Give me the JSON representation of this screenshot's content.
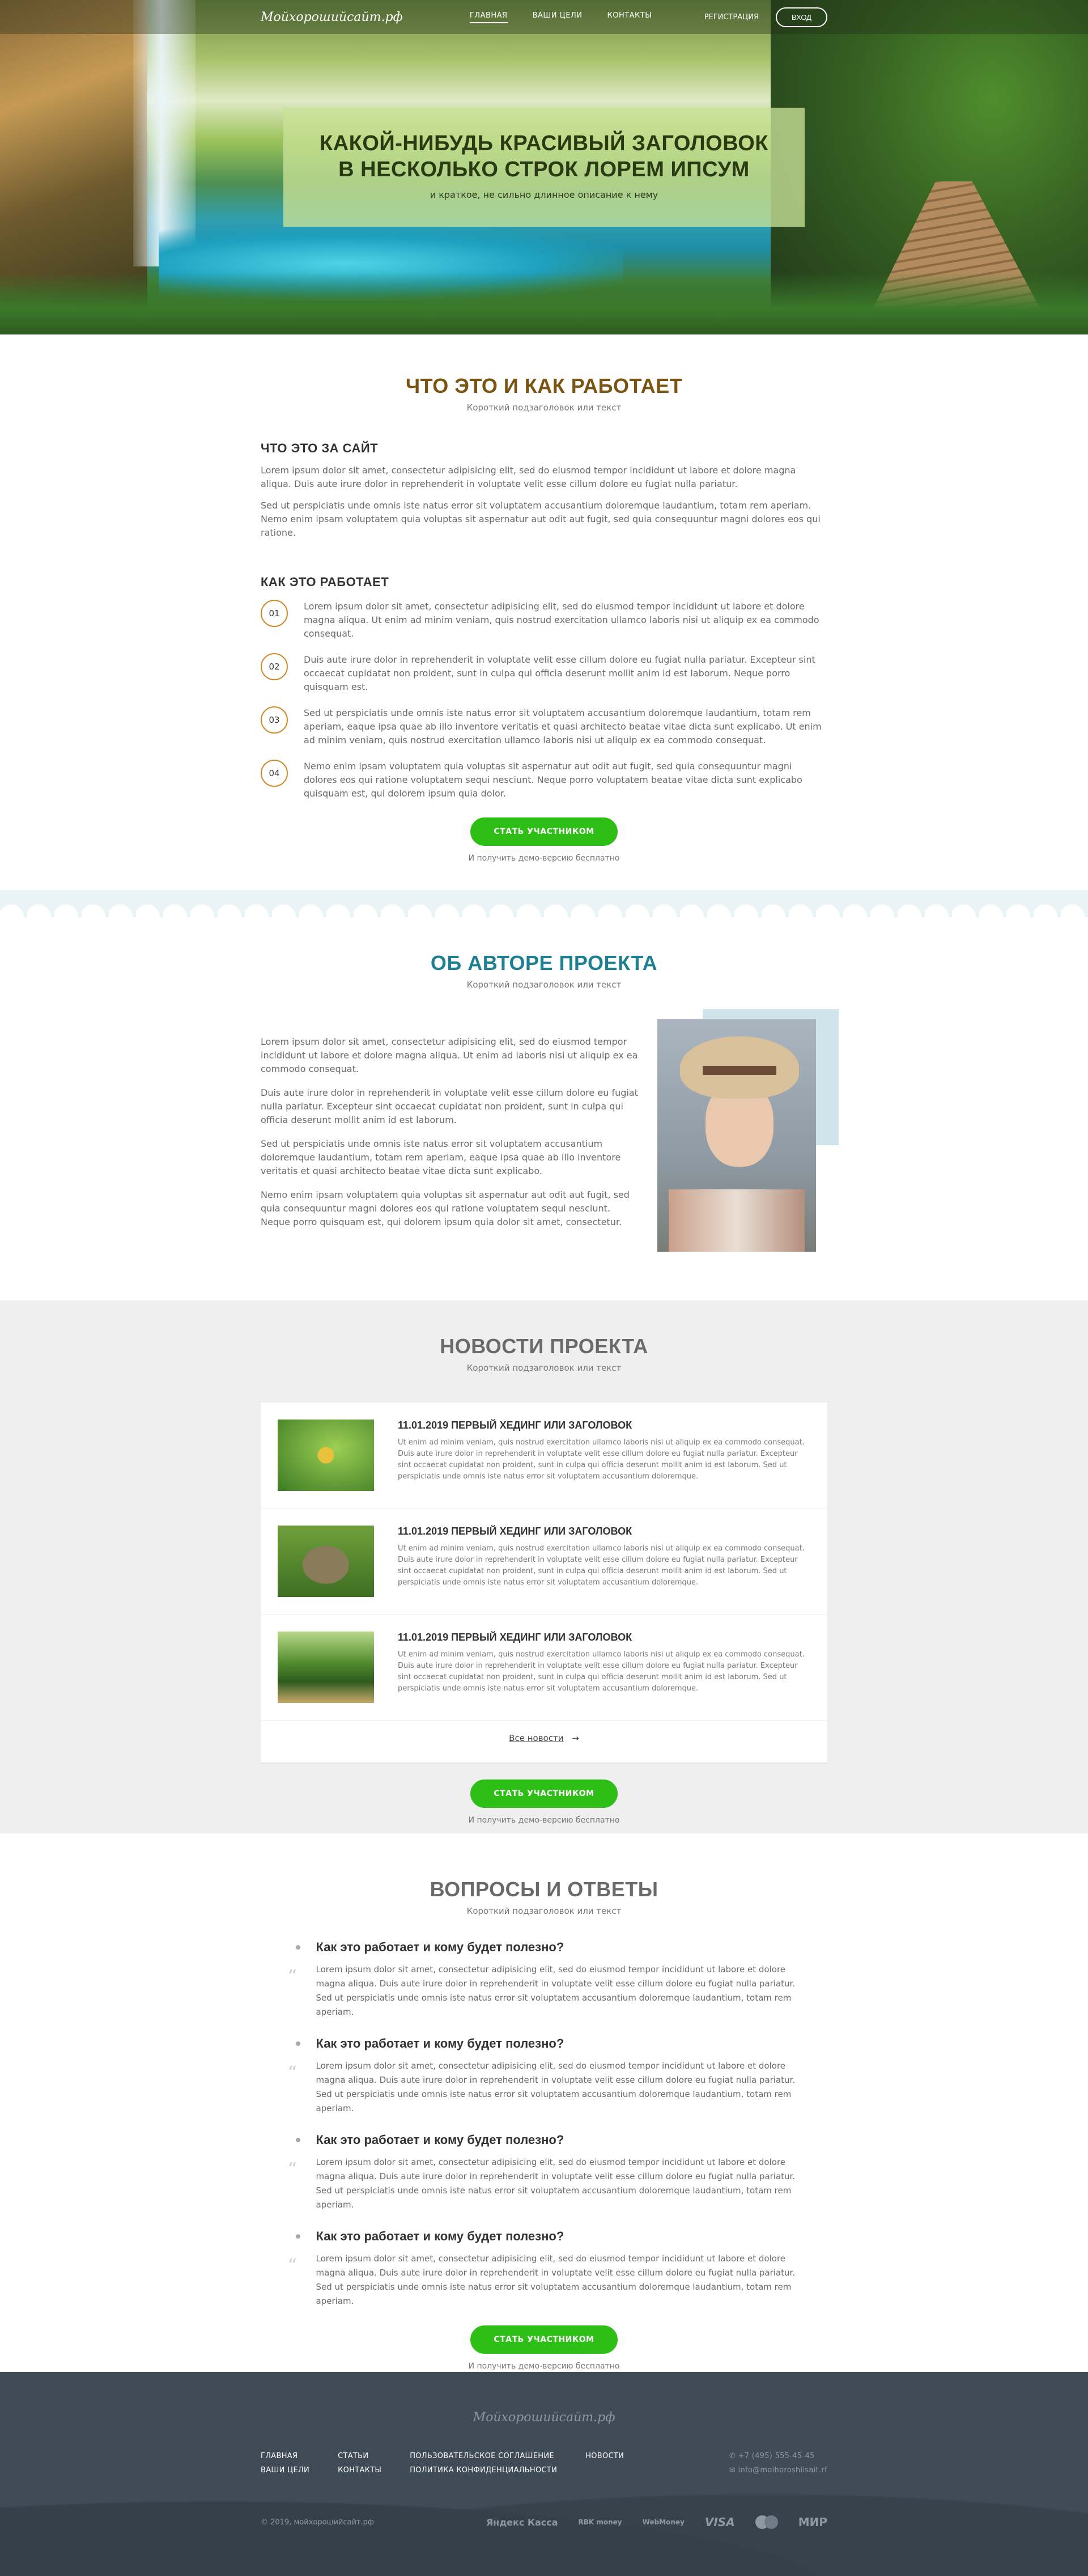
{
  "header": {
    "logo": "Мойхорошийсайт.рф",
    "nav": [
      "ГЛАВНАЯ",
      "ВАШИ ЦЕЛИ",
      "КОНТАКТЫ"
    ],
    "register": "РЕГИСТРАЦИЯ",
    "login": "ВХОД"
  },
  "hero": {
    "title_line1": "КАКОЙ-НИБУДЬ КРАСИВЫЙ ЗАГОЛОВОК",
    "title_line2": "В НЕСКОЛЬКО СТРОК ЛОРЕМ ИПСУМ",
    "description": "и краткое, не сильно длинное описание к нему"
  },
  "how": {
    "title": "ЧТО ЭТО И КАК РАБОТАЕТ",
    "subtitle": "Короткий подзаголовок или текст",
    "about_heading": "ЧТО ЭТО ЗА САЙТ",
    "about_p1": "Lorem ipsum dolor sit amet, consectetur adipisicing elit, sed do eiusmod tempor incididunt ut labore et dolore magna aliqua. Duis aute irure dolor in reprehenderit in voluptate velit esse cillum dolore eu fugiat nulla pariatur.",
    "about_p2": "Sed ut perspiciatis unde omnis iste natus error sit voluptatem accusantium doloremque laudantium, totam rem aperiam. Nemo enim ipsam voluptatem quia voluptas sit aspernatur aut odit aut fugit, sed quia consequuntur magni dolores eos qui ratione.",
    "steps_heading": "КАК ЭТО РАБОТАЕТ",
    "steps": [
      {
        "num": "01",
        "text": "Lorem ipsum dolor sit amet, consectetur adipisicing elit, sed do eiusmod tempor incididunt ut labore et dolore magna aliqua. Ut enim ad minim veniam, quis nostrud exercitation ullamco laboris nisi ut aliquip ex ea commodo consequat."
      },
      {
        "num": "02",
        "text": "Duis aute irure dolor in reprehenderit in voluptate velit esse cillum dolore eu fugiat nulla pariatur. Excepteur sint occaecat cupidatat non proident, sunt in culpa qui officia deserunt mollit anim id est laborum. Neque porro quisquam est."
      },
      {
        "num": "03",
        "text": "Sed ut perspiciatis unde omnis iste natus error sit voluptatem accusantium doloremque laudantium, totam rem aperiam, eaque ipsa quae ab illo inventore veritatis et quasi architecto beatae vitae dicta sunt explicabo. Ut enim ad minim veniam, quis nostrud exercitation ullamco laboris nisi ut aliquip ex ea commodo consequat."
      },
      {
        "num": "04",
        "text": "Nemo enim ipsam voluptatem quia voluptas sit aspernatur aut odit aut fugit, sed quia consequuntur magni dolores eos qui ratione voluptatem sequi nesciunt. Neque porro voluptatem beatae vitae dicta sunt explicabo quisquam est, qui dolorem ipsum quia dolor."
      }
    ],
    "cta": "СТАТЬ УЧАСТНИКОМ",
    "cta_note": "И получить демо-версию бесплатно"
  },
  "author": {
    "title": "ОБ АВТОРЕ ПРОЕКТА",
    "subtitle": "Короткий подзаголовок или текст",
    "paragraphs": [
      "Lorem ipsum dolor sit amet, consectetur adipisicing elit, sed do eiusmod tempor incididunt ut labore et dolore magna aliqua. Ut enim ad laboris nisi ut aliquip ex ea commodo consequat.",
      "Duis aute irure dolor in reprehenderit in voluptate velit esse cillum dolore eu fugiat nulla pariatur. Excepteur sint occaecat cupidatat non proident, sunt in culpa qui officia deserunt mollit anim id est laborum.",
      "Sed ut perspiciatis unde omnis iste natus error sit voluptatem accusantium doloremque laudantium, totam rem aperiam, eaque ipsa quae ab illo inventore veritatis et quasi architecto beatae vitae dicta sunt explicabo.",
      "Nemo enim ipsam voluptatem quia voluptas sit aspernatur aut odit aut fugit, sed quia consequuntur magni dolores eos qui ratione voluptatem sequi nesciunt. Neque porro quisquam est, qui dolorem ipsum quia dolor sit amet, consectetur."
    ]
  },
  "news": {
    "title": "НОВОСТИ ПРОЕКТА",
    "subtitle": "Короткий подзаголовок или текст",
    "items": [
      {
        "title": "11.01.2019 ПЕРВЫЙ ХЕДИНГ ИЛИ ЗАГОЛОВОК",
        "text": "Ut enim ad minim veniam, quis nostrud exercitation ullamco laboris nisi ut aliquip ex ea commodo consequat. Duis aute irure dolor in reprehenderit in voluptate velit esse cillum dolore eu fugiat nulla pariatur. Excepteur sint occaecat cupidatat non proident, sunt in culpa qui officia deserunt mollit anim id est laborum. Sed ut perspiciatis unde omnis iste natus error sit voluptatem accusantium doloremque."
      },
      {
        "title": "11.01.2019 ПЕРВЫЙ ХЕДИНГ ИЛИ ЗАГОЛОВОК",
        "text": "Ut enim ad minim veniam, quis nostrud exercitation ullamco laboris nisi ut aliquip ex ea commodo consequat. Duis aute irure dolor in reprehenderit in voluptate velit esse cillum dolore eu fugiat nulla pariatur. Excepteur sint occaecat cupidatat non proident, sunt in culpa qui officia deserunt mollit anim id est laborum. Sed ut perspiciatis unde omnis iste natus error sit voluptatem accusantium doloremque."
      },
      {
        "title": "11.01.2019 ПЕРВЫЙ ХЕДИНГ ИЛИ ЗАГОЛОВОК",
        "text": "Ut enim ad minim veniam, quis nostrud exercitation ullamco laboris nisi ut aliquip ex ea commodo consequat. Duis aute irure dolor in reprehenderit in voluptate velit esse cillum dolore eu fugiat nulla pariatur. Excepteur sint occaecat cupidatat non proident, sunt in culpa qui officia deserunt mollit anim id est laborum. Sed ut perspiciatis unde omnis iste natus error sit voluptatem accusantium doloremque."
      }
    ],
    "all_link": "Все новости",
    "cta": "СТАТЬ УЧАСТНИКОМ",
    "cta_note": "И получить демо-версию бесплатно"
  },
  "faq": {
    "title": "ВОПРОСЫ И ОТВЕТЫ",
    "subtitle": "Короткий подзаголовок или текст",
    "items": [
      {
        "q": "Как это работает и кому будет полезно?",
        "a": "Lorem ipsum dolor sit amet, consectetur adipisicing elit, sed do eiusmod tempor incididunt ut labore et dolore magna aliqua. Duis aute irure dolor in reprehenderit in voluptate velit esse cillum dolore eu fugiat nulla pariatur. Sed ut perspiciatis unde omnis iste natus error sit voluptatem accusantium doloremque laudantium, totam rem aperiam."
      },
      {
        "q": "Как это работает и кому будет полезно?",
        "a": "Lorem ipsum dolor sit amet, consectetur adipisicing elit, sed do eiusmod tempor incididunt ut labore et dolore magna aliqua. Duis aute irure dolor in reprehenderit in voluptate velit esse cillum dolore eu fugiat nulla pariatur. Sed ut perspiciatis unde omnis iste natus error sit voluptatem accusantium doloremque laudantium, totam rem aperiam."
      },
      {
        "q": "Как это работает и кому будет полезно?",
        "a": "Lorem ipsum dolor sit amet, consectetur adipisicing elit, sed do eiusmod tempor incididunt ut labore et dolore magna aliqua. Duis aute irure dolor in reprehenderit in voluptate velit esse cillum dolore eu fugiat nulla pariatur. Sed ut perspiciatis unde omnis iste natus error sit voluptatem accusantium doloremque laudantium, totam rem aperiam."
      },
      {
        "q": "Как это работает и кому будет полезно?",
        "a": "Lorem ipsum dolor sit amet, consectetur adipisicing elit, sed do eiusmod tempor incididunt ut labore et dolore magna aliqua. Duis aute irure dolor in reprehenderit in voluptate velit esse cillum dolore eu fugiat nulla pariatur. Sed ut perspiciatis unde omnis iste natus error sit voluptatem accusantium doloremque laudantium, totam rem aperiam."
      }
    ],
    "cta": "СТАТЬ УЧАСТНИКОМ",
    "cta_note": "И получить демо-версию бесплатно"
  },
  "footer": {
    "logo": "Мойхорошийсайт.рф",
    "col1": [
      "ГЛАВНАЯ",
      "ВАШИ ЦЕЛИ"
    ],
    "col2": [
      "СТАТЬИ",
      "КОНТАКТЫ"
    ],
    "col3": [
      "ПОЛЬЗОВАТЕЛЬСКОЕ СОГЛАШЕНИЕ",
      "ПОЛИТИКА КОНФИДЕНЦИАЛЬНОСТИ"
    ],
    "col4": [
      "НОВОСТИ"
    ],
    "phone": "+7 (495) 555-45-45",
    "email": "info@moihoroshiisait.rf",
    "copyright": "© 2019, мойхорошийсайт.рф",
    "payments": [
      "Яндекс Касса",
      "RBK money",
      "WebMoney",
      "VISA",
      "MasterCard",
      "МИР"
    ]
  }
}
